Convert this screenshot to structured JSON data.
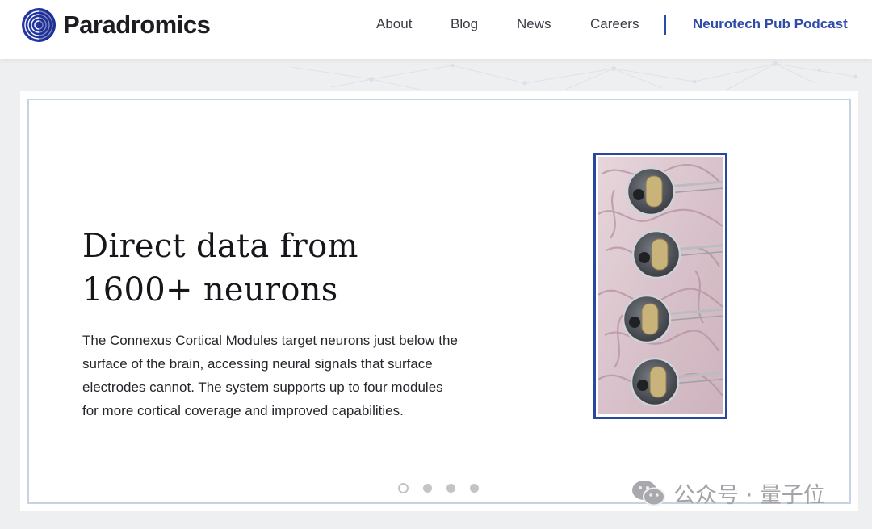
{
  "header": {
    "brand": "Paradromics",
    "nav": [
      {
        "label": "About"
      },
      {
        "label": "Blog"
      },
      {
        "label": "News"
      },
      {
        "label": "Careers"
      }
    ],
    "podcast_link": "Neurotech Pub Podcast"
  },
  "hero": {
    "headline_line1": "Direct data from",
    "headline_line2": "1600+ neurons",
    "body": "The Connexus Cortical Modules target neurons just below the surface of the brain, accessing neural signals that surface electrodes cannot. The system supports up to four modules for more cortical coverage and improved capabilities.",
    "image_icon": "cortical-modules-on-brain-illustration"
  },
  "carousel": {
    "slide_count": 4,
    "active_index": 0
  },
  "watermark": {
    "text": "公众号 · 量子位",
    "icon": "wechat-icon"
  },
  "colors": {
    "brand_blue": "#2f4ba8",
    "frame_blue": "#2847a0",
    "card_border": "#c6d3e3",
    "page_bg": "#eeeff1"
  }
}
